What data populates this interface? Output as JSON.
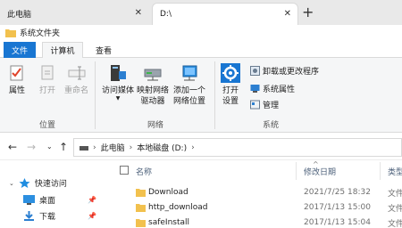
{
  "tabs": [
    {
      "label": "此电脑",
      "active": false
    },
    {
      "label": "D:\\",
      "active": true
    }
  ],
  "window_title": "系统文件夹",
  "ribbon_tabs": {
    "file": "文件",
    "computer": "计算机",
    "view": "查看"
  },
  "ribbon": {
    "location_group": {
      "label": "位置",
      "properties": "属性",
      "open": "打开",
      "rename": "重命名"
    },
    "network_group": {
      "label": "网络",
      "access_media": "访问媒体",
      "map_drive_line1": "映射网络",
      "map_drive_line2": "驱动器",
      "add_location_line1": "添加一个",
      "add_location_line2": "网络位置"
    },
    "system_group": {
      "label": "系统",
      "open_settings_line1": "打开",
      "open_settings_line2": "设置",
      "uninstall": "卸载或更改程序",
      "system_properties": "系统属性",
      "manage": "管理"
    }
  },
  "address": {
    "crumbs": [
      "此电脑",
      "本地磁盘 (D:)"
    ]
  },
  "nav": {
    "quick_access": "快速访问",
    "desktop": "桌面",
    "downloads": "下载"
  },
  "columns": {
    "name": "名称",
    "modified": "修改日期",
    "type": "类型"
  },
  "files": [
    {
      "name": "Download",
      "modified": "2021/7/25 18:32",
      "type": "文件"
    },
    {
      "name": "http_download",
      "modified": "2017/1/13 15:00",
      "type": "文件"
    },
    {
      "name": "safeInstall",
      "modified": "2017/1/13 15:04",
      "type": "文件"
    }
  ],
  "colors": {
    "accent": "#1976d2",
    "folder": "#f2c14e",
    "ribbon_bg": "#f5f6f7"
  }
}
